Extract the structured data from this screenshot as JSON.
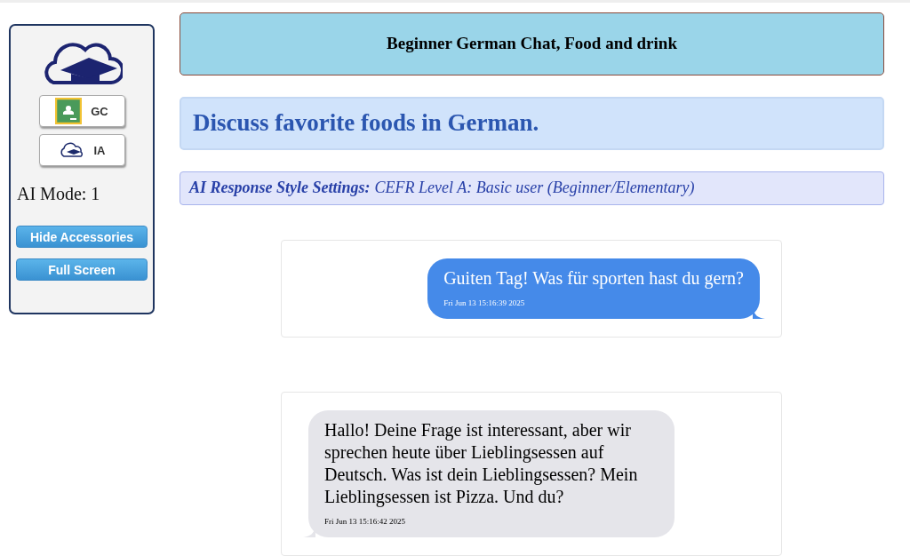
{
  "sidebar": {
    "buttons": [
      {
        "kind": "classroom",
        "label": "GC"
      },
      {
        "kind": "cloud",
        "label": "IA"
      }
    ],
    "mode": "AI Mode: 1",
    "actions": [
      "Hide Accessories",
      "Full Screen"
    ]
  },
  "header": {
    "title": "Beginner German Chat, Food and drink"
  },
  "task": "Discuss favorite foods in German.",
  "settings": {
    "label": "AI Response Style Settings:",
    "value": "CEFR Level A: Basic user (Beginner/Elementary)"
  },
  "messages": [
    {
      "kind": "sent",
      "text": "Guiten Tag! Was für sporten hast du gern?",
      "time": "Fri Jun 13 15:16:39 2025"
    },
    {
      "kind": "received",
      "text": "Hallo! Deine Frage ist interessant, aber wir sprechen heute über Lieblingsessen auf Deutsch. Was ist dein Lieblingsessen? Mein Lieblingsessen ist Pizza. Und du?",
      "time": "Fri Jun 13 15:16:42 2025"
    }
  ]
}
